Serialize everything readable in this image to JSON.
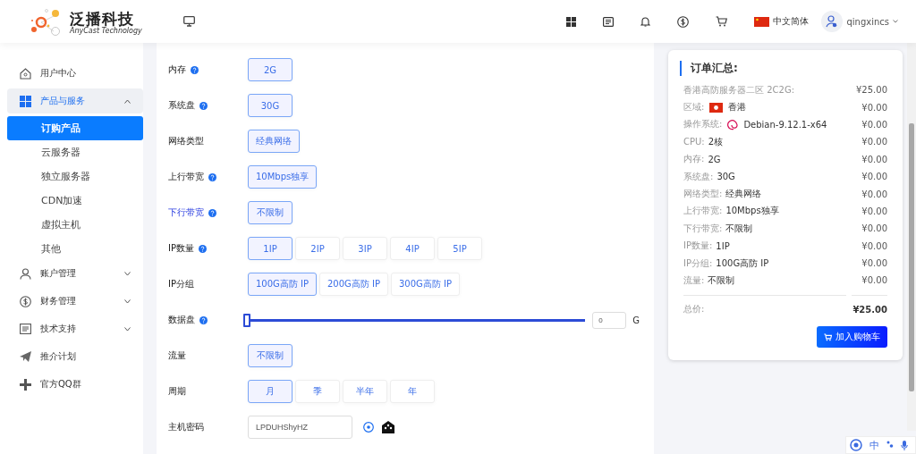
{
  "header": {
    "brand": "泛播科技",
    "brand_sub": "AnyCast Technology",
    "language": "中文简体",
    "username": "qingxincs"
  },
  "sidebar": {
    "items": [
      {
        "label": "用户中心",
        "selected": false
      },
      {
        "label": "产品与服务",
        "selected": false,
        "expanded": true,
        "children": [
          {
            "label": "订购产品",
            "selected": true
          },
          {
            "label": "云服务器",
            "selected": false
          },
          {
            "label": "独立服务器",
            "selected": false
          },
          {
            "label": "CDN加速",
            "selected": false
          },
          {
            "label": "虚拟主机",
            "selected": false
          },
          {
            "label": "其他",
            "selected": false
          }
        ]
      },
      {
        "label": "账户管理",
        "selected": false,
        "expanded": false
      },
      {
        "label": "财务管理",
        "selected": false,
        "expanded": false
      },
      {
        "label": "技术支持",
        "selected": false,
        "expanded": false
      },
      {
        "label": "推介计划",
        "selected": false
      },
      {
        "label": "官方QQ群",
        "selected": false
      }
    ]
  },
  "form": {
    "fields": [
      {
        "kind": "options",
        "label": "内存",
        "help": true,
        "highlighted": false,
        "options": [
          {
            "label": "2G",
            "selected": true
          }
        ]
      },
      {
        "kind": "options",
        "label": "系统盘",
        "help": true,
        "highlighted": false,
        "options": [
          {
            "label": "30G",
            "selected": true
          }
        ]
      },
      {
        "kind": "options",
        "label": "网络类型",
        "help": false,
        "highlighted": false,
        "options": [
          {
            "label": "经典网络",
            "selected": true
          }
        ]
      },
      {
        "kind": "options",
        "label": "上行带宽",
        "help": true,
        "highlighted": false,
        "options": [
          {
            "label": "10Mbps独享",
            "selected": true
          }
        ]
      },
      {
        "kind": "options",
        "label": "下行带宽",
        "help": true,
        "highlighted": true,
        "options": [
          {
            "label": "不限制",
            "selected": true
          }
        ]
      },
      {
        "kind": "options",
        "label": "IP数量",
        "help": true,
        "highlighted": false,
        "options": [
          {
            "label": "1IP",
            "selected": true
          },
          {
            "label": "2IP",
            "selected": false
          },
          {
            "label": "3IP",
            "selected": false
          },
          {
            "label": "4IP",
            "selected": false
          },
          {
            "label": "5IP",
            "selected": false
          }
        ]
      },
      {
        "kind": "options",
        "label": "IP分组",
        "help": false,
        "highlighted": false,
        "options": [
          {
            "label": "100G高防 IP",
            "selected": true
          },
          {
            "label": "200G高防 IP",
            "selected": false
          },
          {
            "label": "300G高防 IP",
            "selected": false
          }
        ]
      },
      {
        "kind": "slider",
        "label": "数据盘",
        "help": true,
        "highlighted": false,
        "level": 0,
        "value": "0",
        "unit": "G"
      },
      {
        "kind": "options",
        "label": "流量",
        "help": false,
        "highlighted": false,
        "options": [
          {
            "label": "不限制",
            "selected": true
          }
        ]
      },
      {
        "kind": "options",
        "label": "周期",
        "help": false,
        "highlighted": false,
        "options": [
          {
            "label": "月",
            "selected": true
          },
          {
            "label": "季",
            "selected": false
          },
          {
            "label": "半年",
            "selected": false
          },
          {
            "label": "年",
            "selected": false
          }
        ]
      },
      {
        "kind": "password",
        "label": "主机密码",
        "help": false,
        "highlighted": false,
        "value": "LPDUHShyHZ"
      }
    ]
  },
  "summary": {
    "title": "订单汇总:",
    "lines": [
      {
        "kind": "plain",
        "label": "香港高防服务器二区 2C2G:",
        "price": "¥25.00"
      },
      {
        "kind": "flag",
        "label": "区域:",
        "value": "香港",
        "price": "¥0.00"
      },
      {
        "kind": "os",
        "label": "操作系统:",
        "value": "Debian-9.12.1-x64",
        "price": "¥0.00"
      },
      {
        "kind": "plain",
        "label": "CPU:",
        "value": "2核",
        "price": "¥0.00"
      },
      {
        "kind": "plain",
        "label": "内存:",
        "value": "2G",
        "price": "¥0.00"
      },
      {
        "kind": "plain",
        "label": "系统盘:",
        "value": "30G",
        "price": "¥0.00"
      },
      {
        "kind": "plain",
        "label": "网络类型:",
        "value": "经典网络",
        "price": "¥0.00"
      },
      {
        "kind": "plain",
        "label": "上行带宽:",
        "value": "10Mbps独享",
        "price": "¥0.00"
      },
      {
        "kind": "plain",
        "label": "下行带宽:",
        "value": "不限制",
        "price": "¥0.00"
      },
      {
        "kind": "plain",
        "label": "IP数量:",
        "value": "1IP",
        "price": "¥0.00"
      },
      {
        "kind": "plain",
        "label": "IP分组:",
        "value": "100G高防 IP",
        "price": "¥0.00"
      },
      {
        "kind": "plain",
        "label": "流量:",
        "value": "不限制",
        "price": "¥0.00"
      }
    ],
    "total_label": "总价:",
    "total": "¥25.00",
    "button": "加入购物车"
  },
  "ime_toolbar": {
    "label": "中"
  }
}
